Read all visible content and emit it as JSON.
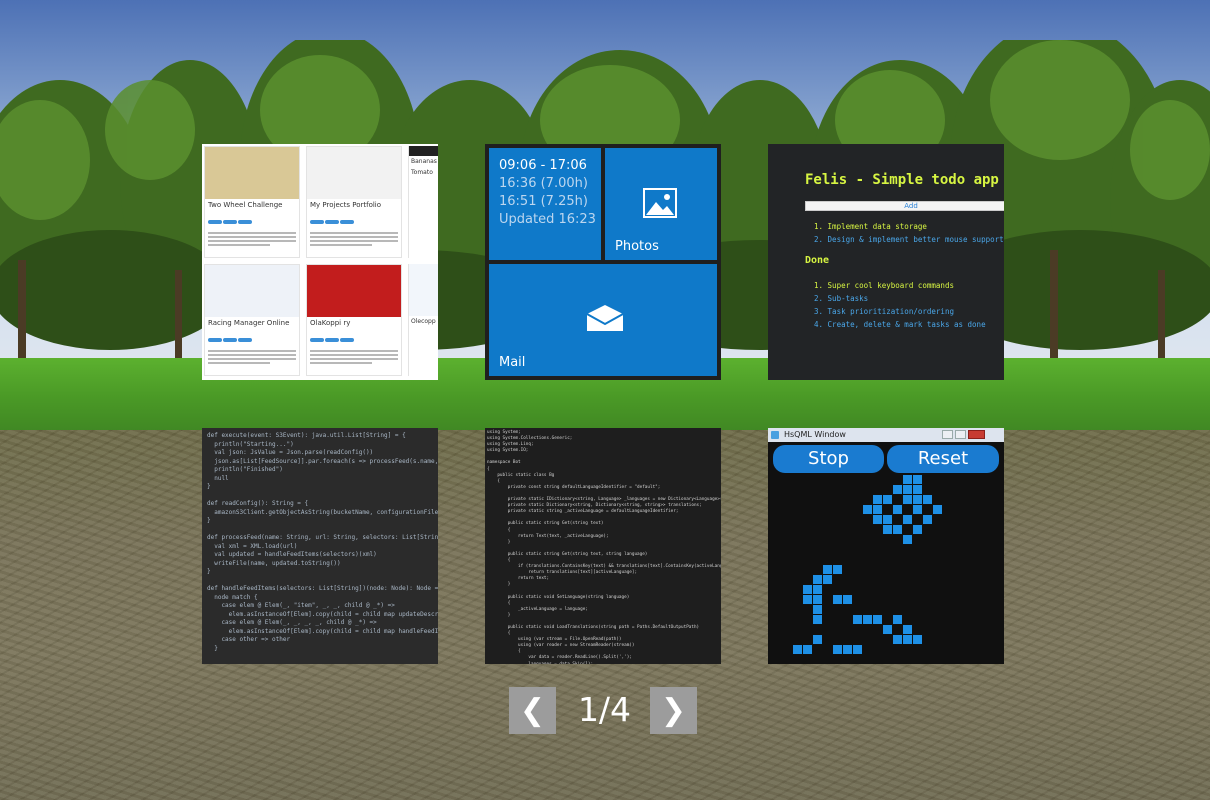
{
  "portfolio": {
    "cards": [
      {
        "title": "Two Wheel Challenge",
        "img": "#d9c896"
      },
      {
        "title": "My Projects Portfolio",
        "img": "#f2f2f2"
      },
      {
        "title": "Racing Manager Online",
        "img": "#eef2f8"
      },
      {
        "title": "OlaKoppi ry",
        "img": "#c21d1d"
      }
    ],
    "side_items": [
      "Bananas",
      "Tomato",
      "Olecopp"
    ]
  },
  "tiles": {
    "time_line1": "09:06 - 17:06",
    "time_line2": "16:36 (7.00h)",
    "time_line3": "16:51 (7.25h)",
    "time_line4": "Updated 16:23",
    "photos_label": "Photos",
    "photos_icon": "image-icon",
    "mail_label": "Mail",
    "mail_icon": "envelope-icon",
    "accent": "#0f79c9"
  },
  "todo": {
    "title": "Felis - Simple todo app",
    "add_label": "Add",
    "pending": [
      "1.  Implement data storage",
      "2.  Design & implement better mouse support"
    ],
    "done_heading": "Done",
    "done": [
      "1.  Super cool keyboard commands",
      "2.  Sub-tasks",
      "3.  Task prioritization/ordering",
      "4.  Create, delete & mark tasks as done"
    ]
  },
  "scala_code": "def execute(event: S3Event): java.util.List[String] = {\n  println(\"Starting...\")\n  val json: JsValue = Json.parse(readConfig())\n  json.as[List[FeedSource]].par.foreach(s => processFeed(s.name, s.\n  println(\"Finished\")\n  null\n}\n\ndef readConfig(): String = {\n  amazonS3Client.getObjectAsString(bucketName, configurationFileKe\n}\n\ndef processFeed(name: String, url: String, selectors: List[String]) \n  val xml = XML.load(url)\n  val updated = handleFeedItems(selectors)(xml)\n  writeFile(name, updated.toString())\n}\n\ndef handleFeedItems(selectors: List[String])(node: Node): Node = {\n  node match {\n    case elem @ Elem(_, \"item\", _, _, child @ _*) =>\n      elem.asInstanceOf[Elem].copy(child = child map updateDescript\n    case elem @ Elem(_, _, _, _, child @ _*) =>\n      elem.asInstanceOf[Elem].copy(child = child map handleFeedItem\n    case other => other\n  }",
  "csharp_code": "using System;\nusing System.Collections.Generic;\nusing System.Linq;\nusing System.IO;\n\nnamespace Bot\n{\n    public static class Bg\n    {\n        private const string defaultLanguageIdentifier = \"default\";\n\n        private static IDictionary<string, Language> _languages = new Dictionary<Language>();\n        private static Dictionary<string, Dictionary<string, string>> translations;\n        private static string _activeLanguage = defaultLanguageIdentifier;\n\n        public static string Get(string text)\n        {\n            return Text(text, _activeLanguage);\n        }\n\n        public static string Get(string text, string language)\n        {\n            if (translations.ContainsKey(text) && translations[text].ContainsKey(activeLanguage))\n                return translations[text][activeLanguage];\n            return text;\n        }\n\n        public static void SetLanguage(string language)\n        {\n            _activeLanguage = language;\n        }\n\n        public static void LoadTranslations(string path = Paths.DefaultOutputPath)\n        {\n            using (var stream = File.OpenRead(path))\n            using (var reader = new StreamReader(stream))\n            {\n                var data = reader.ReadLine().Split(',');\n                languages = data.Skip(1);\n                translations = ReadEntries(stream, data.Skip(1), language);\n            }",
  "qml": {
    "window_title": "HsQML Window",
    "stop_label": "Stop",
    "reset_label": "Reset"
  },
  "pager": {
    "prev_label": "❮",
    "next_label": "❯",
    "indicator": "1/4"
  }
}
